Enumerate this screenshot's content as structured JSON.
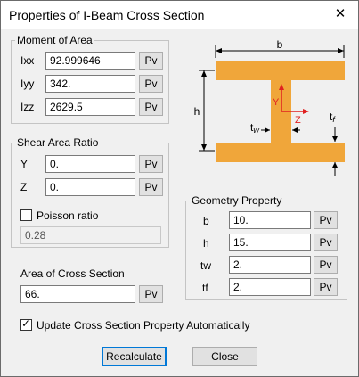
{
  "window": {
    "title": "Properties of I-Beam Cross Section",
    "close_icon": "close-icon"
  },
  "moment": {
    "legend": "Moment of Area",
    "rows": [
      {
        "label": "Ixx",
        "value": "92.999646",
        "btn": "Pv"
      },
      {
        "label": "Iyy",
        "value": "342.",
        "btn": "Pv"
      },
      {
        "label": "Izz",
        "value": "2629.5",
        "btn": "Pv"
      }
    ]
  },
  "shear": {
    "legend": "Shear Area Ratio",
    "rows": [
      {
        "label": "Y",
        "value": "0.",
        "btn": "Pv"
      },
      {
        "label": "Z",
        "value": "0.",
        "btn": "Pv"
      }
    ],
    "poisson_label": "Poisson ratio",
    "poisson_checked": false,
    "poisson_value": "0.28"
  },
  "area": {
    "label": "Area of Cross Section",
    "value": "66.",
    "btn": "Pv"
  },
  "geometry": {
    "legend": "Geometry Property",
    "rows": [
      {
        "label": "b",
        "value": "10.",
        "btn": "Pv"
      },
      {
        "label": "h",
        "value": "15.",
        "btn": "Pv"
      },
      {
        "label": "tw",
        "value": "2.",
        "btn": "Pv"
      },
      {
        "label": "tf",
        "value": "2.",
        "btn": "Pv"
      }
    ]
  },
  "diagram": {
    "b": "b",
    "h": "h",
    "tw_t": "t",
    "tw_sub": "w",
    "tf_t": "t",
    "tf_sub": "f",
    "axis_y": "Y",
    "axis_z": "Z",
    "beam_color": "#f0a63a",
    "axis_color": "#e02020"
  },
  "update": {
    "label": "Update Cross Section Property Automatically",
    "checked": true
  },
  "buttons": {
    "recalc": "Recalculate",
    "close": "Close"
  }
}
